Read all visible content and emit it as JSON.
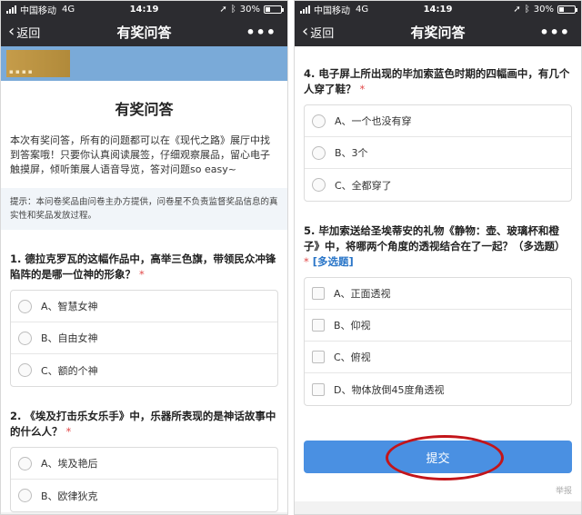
{
  "status": {
    "carrier": "中国移动",
    "network": "4G",
    "time": "14:19",
    "battery": "30%",
    "battery_level": 0.3
  },
  "nav": {
    "back": "返回",
    "title": "有奖问答",
    "more": "•••"
  },
  "page": {
    "title": "有奖问答",
    "intro": "本次有奖问答，所有的问题都可以在《现代之路》展厅中找到答案哦！只要你认真阅读展签，仔细观察展品，留心电子触摸屏，倾听策展人语音导览，答对问题so easy~",
    "notice_label": "提示：",
    "notice": "本问卷奖品由问卷主办方提供，问卷星不负责监督奖品信息的真实性和奖品发放过程。"
  },
  "questions": [
    {
      "title": "1. 德拉克罗瓦的这幅作品中，高举三色旗，带领民众冲锋陷阵的是哪一位神的形象？",
      "required": "*",
      "options": [
        "A、智慧女神",
        "B、自由女神",
        "C、额的个神"
      ]
    },
    {
      "title": "2. 《埃及打击乐女乐手》中，乐器所表现的是神话故事中的什么人？",
      "required": "*",
      "options": [
        "A、埃及艳后",
        "B、欧律狄克"
      ]
    },
    {
      "title": "4. 电子屏上所出现的毕加索蓝色时期的四幅画中，有几个人穿了鞋？",
      "required": "*",
      "options": [
        "A、一个也没有穿",
        "B、3个",
        "C、全都穿了"
      ]
    },
    {
      "title": "5. 毕加索送给圣埃蒂安的礼物《静物：壶、玻璃杯和橙子》中，将哪两个角度的透视结合在了一起？（多选题）",
      "required": "*",
      "multi": "[多选题]",
      "options": [
        "A、正面透视",
        "B、仰视",
        "C、俯视",
        "D、物体放倒45度角透视"
      ]
    }
  ],
  "footer": {
    "submit": "提交",
    "report": "举报"
  }
}
